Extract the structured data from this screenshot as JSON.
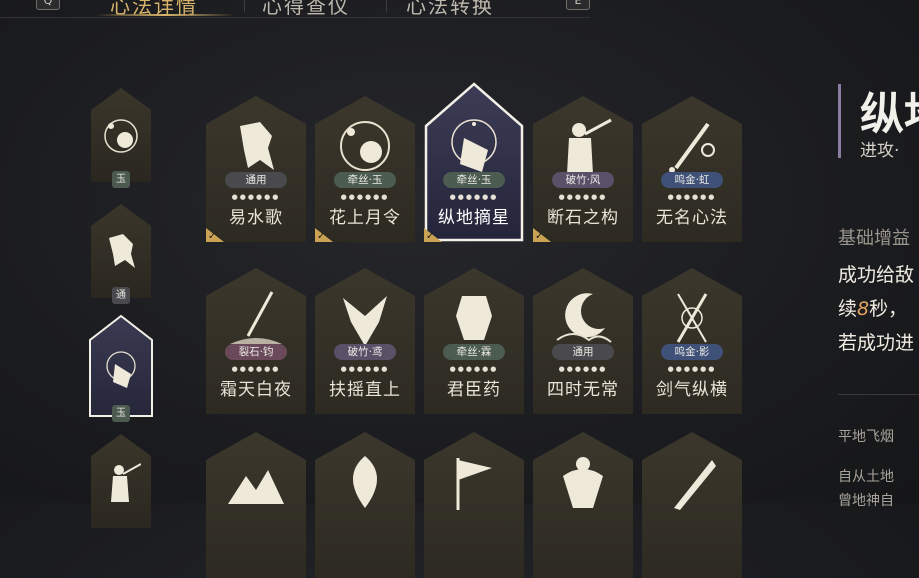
{
  "tabs": [
    {
      "label": "心法详情",
      "active": true
    },
    {
      "label": "心得查仪",
      "active": false
    },
    {
      "label": "心法转换",
      "active": false
    }
  ],
  "keys": {
    "left": "Q",
    "right": "E"
  },
  "left_column": [
    {
      "tag": "玉",
      "icon": "flower-moon-icon"
    },
    {
      "tag": "通",
      "icon": "horse-icon"
    },
    {
      "tag": "玉",
      "icon": "star-mask-icon",
      "selected": true
    },
    {
      "tag": "",
      "icon": "swordsman-icon"
    }
  ],
  "cards": [
    {
      "name": "易水歌",
      "tag": "通用",
      "tag_color": "#4a4a4e",
      "icon": "horse-icon",
      "dots": "●●●●●●",
      "checked": true
    },
    {
      "name": "花上月令",
      "tag": "牵丝·玉",
      "tag_color": "#4d5c50",
      "icon": "flower-moon-icon",
      "dots": "●●●●●●",
      "checked": true
    },
    {
      "name": "纵地摘星",
      "tag": "牵丝·玉",
      "tag_color": "#4d5c50",
      "icon": "star-mask-icon",
      "dots": "●●●●●●",
      "checked": true,
      "selected": true
    },
    {
      "name": "断石之构",
      "tag": "破竹·风",
      "tag_color": "#5a5068",
      "icon": "swordsman-icon",
      "dots": "●●●●●●",
      "checked": true
    },
    {
      "name": "无名心法",
      "tag": "鸣金·虹",
      "tag_color": "#3f5178",
      "icon": "sword-icon",
      "dots": "●●●●●●",
      "checked": false
    },
    {
      "name": "霜天白夜",
      "tag": "裂石·钧",
      "tag_color": "#6a4a5a",
      "icon": "blade-icon",
      "dots": "●●●●●●",
      "checked": false
    },
    {
      "name": "扶摇直上",
      "tag": "破竹·鸢",
      "tag_color": "#5a5068",
      "icon": "eagle-icon",
      "dots": "●●●●●●",
      "checked": false
    },
    {
      "name": "君臣药",
      "tag": "牵丝·霖",
      "tag_color": "#4d5c50",
      "icon": "pot-icon",
      "dots": "●●●●●●",
      "checked": false
    },
    {
      "name": "四时无常",
      "tag": "通用",
      "tag_color": "#4a4a4e",
      "icon": "moon-cloud-icon",
      "dots": "●●●●●●",
      "checked": false
    },
    {
      "name": "剑气纵横",
      "tag": "鸣金·影",
      "tag_color": "#3f5178",
      "icon": "twin-sword-icon",
      "dots": "●●●●●●",
      "checked": false
    },
    {
      "name": "",
      "tag": "",
      "tag_color": "",
      "icon": "mountain-icon",
      "dots": "",
      "checked": false
    },
    {
      "name": "",
      "tag": "",
      "tag_color": "",
      "icon": "leaf-face-icon",
      "dots": "",
      "checked": false
    },
    {
      "name": "",
      "tag": "",
      "tag_color": "",
      "icon": "flag-icon",
      "dots": "",
      "checked": false
    },
    {
      "name": "",
      "tag": "",
      "tag_color": "",
      "icon": "dancer-icon",
      "dots": "",
      "checked": false
    },
    {
      "name": "",
      "tag": "",
      "tag_color": "",
      "icon": "knife-icon",
      "dots": "",
      "checked": false
    }
  ],
  "detail": {
    "title": "纵地",
    "subtitle": "进攻·",
    "section": "基础增益",
    "line1": "成功给敌",
    "line2_pre": "续",
    "line2_num": "8",
    "line2_post": "秒，",
    "line3": "若成功进",
    "small1": "平地飞烟",
    "small2": "自从土地",
    "small3": "曾地神自"
  },
  "colors": {
    "gold": "#d7b46a",
    "card_bg": "#2d2a22",
    "card_top": "#3b372c",
    "selected_bg": "#33334a",
    "accent_purple": "#8a7ca3",
    "highlight_num": "#e5a35d"
  }
}
